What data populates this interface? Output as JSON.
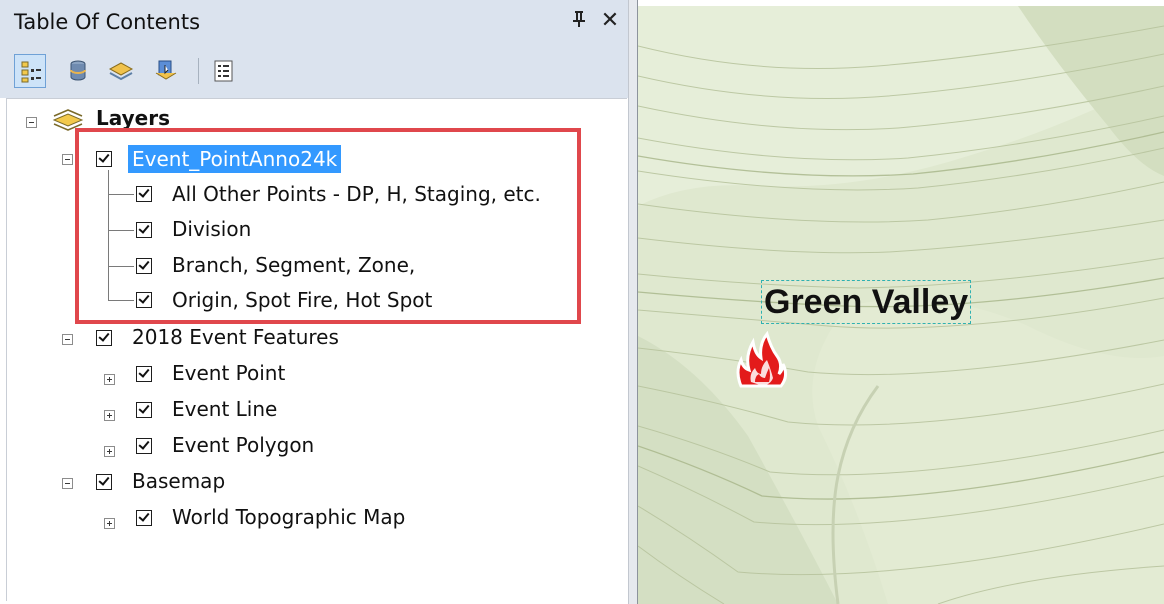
{
  "toc": {
    "title": "Table Of Contents",
    "pin_icon": "pin-icon",
    "close_label": "✕",
    "toolbar": [
      {
        "name": "list-by-drawing-order",
        "icon": "list-by-drawing-order-icon",
        "active": true
      },
      {
        "name": "list-by-source",
        "icon": "list-by-source-icon",
        "active": false
      },
      {
        "name": "list-by-visibility",
        "icon": "list-by-visibility-icon",
        "active": false
      },
      {
        "name": "list-by-selection",
        "icon": "list-by-selection-icon",
        "active": false
      },
      {
        "name": "options",
        "icon": "options-icon",
        "active": false
      }
    ],
    "tree": {
      "root_label": "Layers",
      "groups": [
        {
          "label": "Event_PointAnno24k",
          "checked": true,
          "selected": true,
          "children": [
            {
              "label": "All Other Points - DP, H, Staging, etc.",
              "checked": true
            },
            {
              "label": "Division",
              "checked": true
            },
            {
              "label": "Branch, Segment, Zone,",
              "checked": true
            },
            {
              "label": "Origin, Spot Fire, Hot Spot",
              "checked": true
            }
          ]
        },
        {
          "label": "2018 Event Features",
          "checked": true,
          "children": [
            {
              "label": "Event Point",
              "checked": true
            },
            {
              "label": "Event Line",
              "checked": true
            },
            {
              "label": "Event Polygon",
              "checked": true
            }
          ]
        },
        {
          "label": "Basemap",
          "checked": true,
          "children": [
            {
              "label": "World Topographic Map",
              "checked": true
            }
          ]
        }
      ]
    }
  },
  "map": {
    "label": "Green Valley",
    "marker_icon": "fire-icon"
  },
  "colors": {
    "selection": "#3399ff",
    "highlight_box": "#e0474c",
    "panel_header": "#dbe3ee",
    "map_background": "#dfe8cf"
  }
}
